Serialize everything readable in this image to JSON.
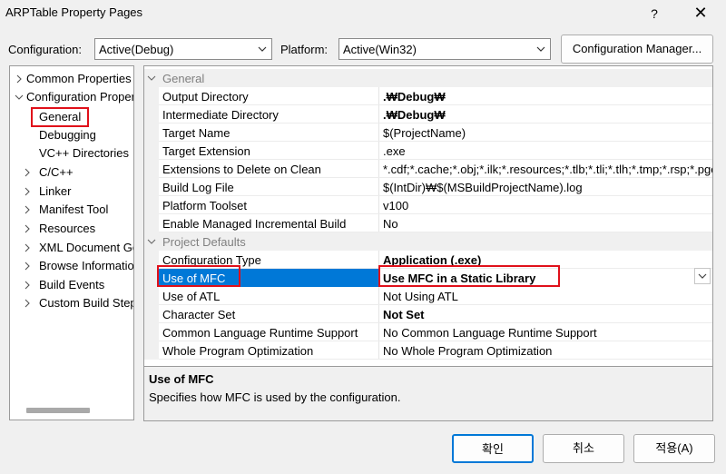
{
  "window": {
    "title": "ARPTable Property Pages",
    "help": "?",
    "close": "✕"
  },
  "toolbar": {
    "configuration_label": "Configuration:",
    "configuration_value": "Active(Debug)",
    "platform_label": "Platform:",
    "platform_value": "Active(Win32)",
    "config_manager_label": "Configuration Manager..."
  },
  "tree": {
    "items": [
      {
        "label": "Common Properties",
        "chevron": "right"
      },
      {
        "label": "Configuration Properties",
        "chevron": "down"
      },
      {
        "label": "General",
        "selected": true
      },
      {
        "label": "Debugging"
      },
      {
        "label": "VC++ Directories"
      },
      {
        "label": "C/C++",
        "chevron": "right"
      },
      {
        "label": "Linker",
        "chevron": "right"
      },
      {
        "label": "Manifest Tool",
        "chevron": "right"
      },
      {
        "label": "Resources",
        "chevron": "right"
      },
      {
        "label": "XML Document Generator",
        "chevron": "right"
      },
      {
        "label": "Browse Information",
        "chevron": "right"
      },
      {
        "label": "Build Events",
        "chevron": "right"
      },
      {
        "label": "Custom Build Step",
        "chevron": "right"
      }
    ]
  },
  "grid": {
    "categories": [
      {
        "name": "General",
        "rows": [
          {
            "name": "Output Directory",
            "value": ".₩Debug₩",
            "bold": true
          },
          {
            "name": "Intermediate Directory",
            "value": ".₩Debug₩",
            "bold": true
          },
          {
            "name": "Target Name",
            "value": "$(ProjectName)"
          },
          {
            "name": "Target Extension",
            "value": ".exe"
          },
          {
            "name": "Extensions to Delete on Clean",
            "value": "*.cdf;*.cache;*.obj;*.ilk;*.resources;*.tlb;*.tli;*.tlh;*.tmp;*.rsp;*.pgc"
          },
          {
            "name": "Build Log File",
            "value": "$(IntDir)₩$(MSBuildProjectName).log"
          },
          {
            "name": "Platform Toolset",
            "value": "v100"
          },
          {
            "name": "Enable Managed Incremental Build",
            "value": "No"
          }
        ]
      },
      {
        "name": "Project Defaults",
        "rows": [
          {
            "name": "Configuration Type",
            "value": "Application (.exe)",
            "bold": true
          },
          {
            "name": "Use of MFC",
            "value": "Use MFC in a Static Library",
            "bold": true,
            "selected": true
          },
          {
            "name": "Use of ATL",
            "value": "Not Using ATL"
          },
          {
            "name": "Character Set",
            "value": "Not Set",
            "bold": true
          },
          {
            "name": "Common Language Runtime Support",
            "value": "No Common Language Runtime Support"
          },
          {
            "name": "Whole Program Optimization",
            "value": "No Whole Program Optimization"
          }
        ]
      }
    ]
  },
  "description": {
    "title": "Use of MFC",
    "text": "Specifies how MFC is used by the configuration."
  },
  "buttons": {
    "ok": "확인",
    "cancel": "취소",
    "apply": "적용(A)"
  },
  "colors": {
    "selection": "#0078d7",
    "highlight_box": "#e0101a",
    "category_text": "#7f7f7f"
  }
}
